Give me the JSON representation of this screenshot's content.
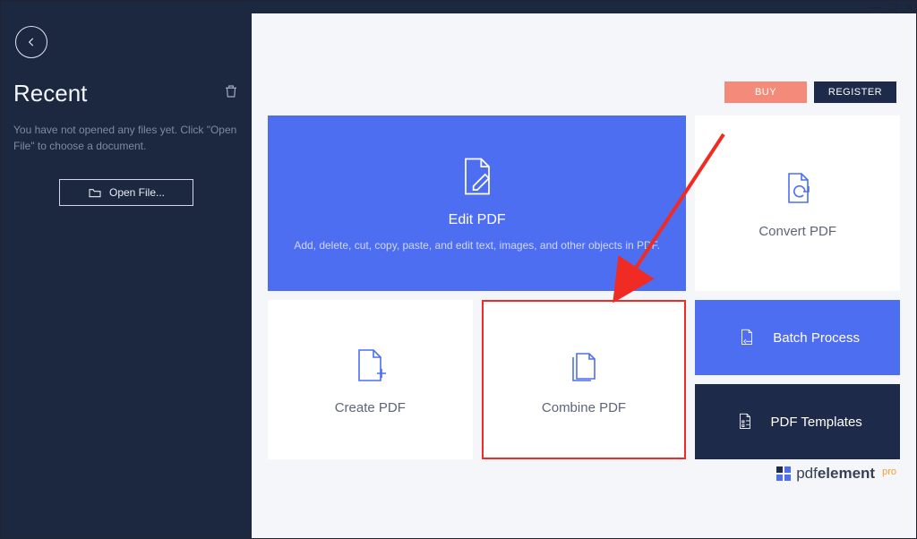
{
  "window": {
    "min": "—",
    "max": "□",
    "close": "×"
  },
  "sidebar": {
    "title": "Recent",
    "hint": "You have not opened any files yet. Click \"Open File\" to choose a document.",
    "open_file_label": "Open File..."
  },
  "actions": {
    "buy_label": "BUY",
    "register_label": "REGISTER"
  },
  "cards": {
    "edit": {
      "title": "Edit PDF",
      "subtitle": "Add, delete, cut, copy, paste, and edit text, images, and other objects in PDF."
    },
    "convert": {
      "title": "Convert PDF"
    },
    "create": {
      "title": "Create PDF"
    },
    "combine": {
      "title": "Combine PDF"
    },
    "batch": {
      "title": "Batch Process"
    },
    "templates": {
      "title": "PDF Templates"
    }
  },
  "brand": {
    "name_light": "pdf",
    "name_bold": "element",
    "tier": "pro"
  },
  "colors": {
    "accent": "#4e6ef2",
    "dark": "#1e2a4a",
    "warn": "#f48b7a",
    "highlight": "#ef2b23"
  }
}
